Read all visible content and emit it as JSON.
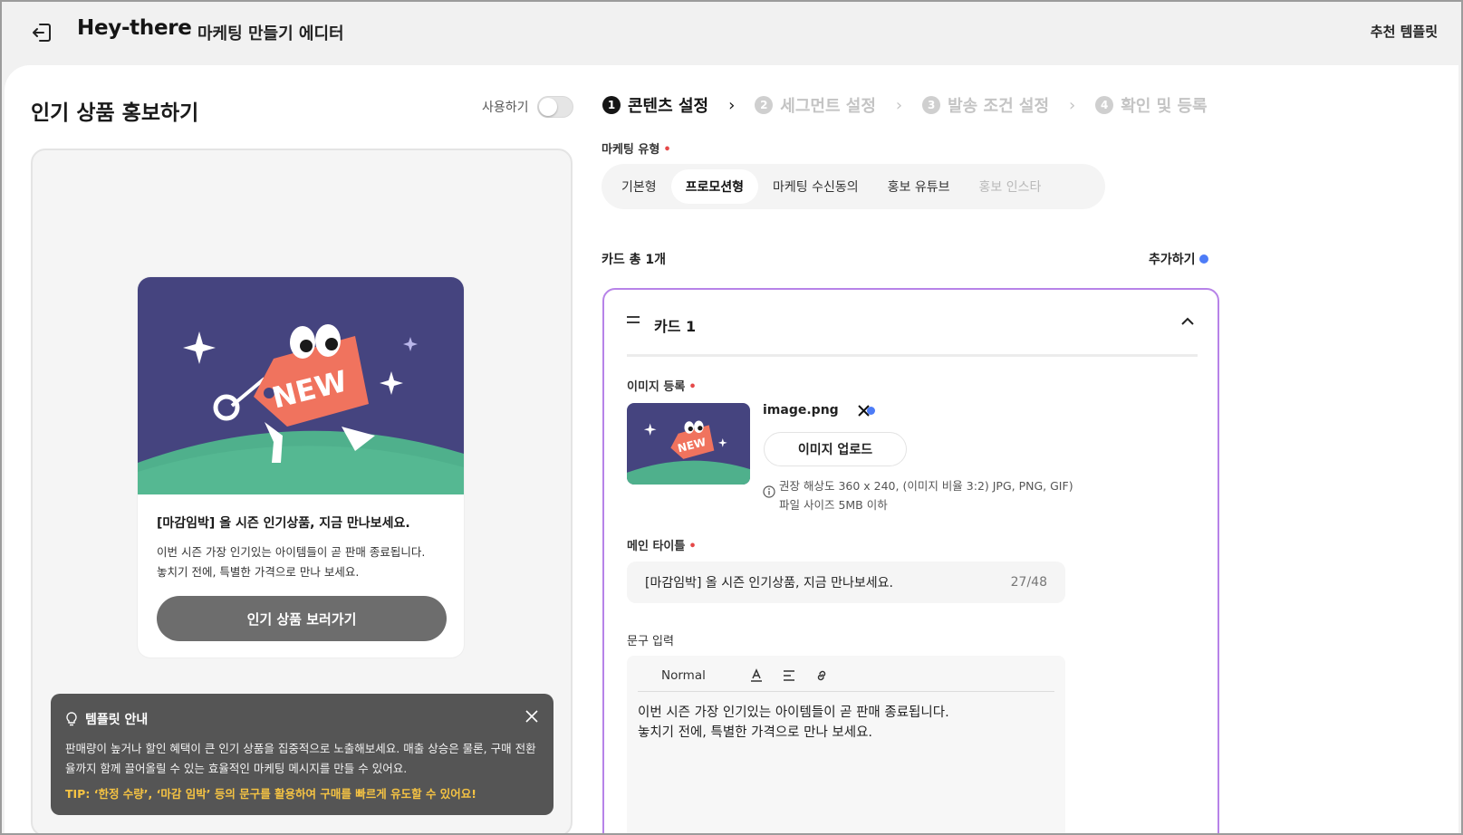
{
  "header": {
    "brand": "Hey-there",
    "subtitle": "마케팅 만들기 에디터",
    "recommend": "추천 템플릿"
  },
  "left": {
    "title": "인기 상품 홍보하기",
    "toggle_label": "사용하기",
    "toggle_on": false,
    "preview": {
      "image_text": "NEW",
      "title": "[마감임박] 올 시즌 인기상품, 지금 만나보세요.",
      "desc": "이번 시즌 가장 인기있는 아이템들이 곧 판매 종료됩니다.\n놓치기 전에, 특별한 가격으로 만나 보세요.",
      "cta": "인기 상품 보러가기"
    },
    "tip": {
      "title": "템플릿 안내",
      "body": "판매량이 높거나 할인 혜택이 큰 인기 상품을 집중적으로 노출해보세요. 매출 상승은 물론, 구매 전환율까지 함께 끌어올릴 수 있는 효율적인 마케팅 메시지를 만들 수 있어요.",
      "tip_line": "TIP: ‘한정 수량’, ‘마감 임박’ 등의 문구를 활용하여 구매를 빠르게 유도할 수 있어요!"
    }
  },
  "steps": [
    {
      "num": "1",
      "label": "콘텐츠 설정",
      "active": true
    },
    {
      "num": "2",
      "label": "세그먼트 설정",
      "active": false
    },
    {
      "num": "3",
      "label": "발송 조건 설정",
      "active": false
    },
    {
      "num": "4",
      "label": "확인 및 등록",
      "active": false
    }
  ],
  "form": {
    "marketing_type_label": "마케팅 유형",
    "types": [
      {
        "label": "기본형",
        "state": "normal"
      },
      {
        "label": "프로모션형",
        "state": "active"
      },
      {
        "label": "마케팅 수신동의",
        "state": "normal"
      },
      {
        "label": "홍보 유튜브",
        "state": "normal"
      },
      {
        "label": "홍보 인스타",
        "state": "disabled"
      }
    ],
    "cards_count": "카드 총 1개",
    "add_label": "추가하기",
    "card": {
      "name": "카드 1",
      "image_label": "이미지 등록",
      "file_name": "image.png",
      "upload_label": "이미지 업로드",
      "upload_hint": "권장 해상도 360 x 240, (이미지 비율 3:2) JPG, PNG, GIF)\n파일 사이즈 5MB 이하",
      "main_title_label": "메인 타이틀",
      "main_title_value": "[마감임박] 올 시즌 인기상품, 지금 만나보세요.",
      "main_title_count": "27/48",
      "text_label": "문구 입력",
      "toolbar_format": "Normal",
      "text_value": "이번 시즌 가장 인기있는 아이템들이 곧 판매 종료됩니다.\n놓치기 전에, 특별한 가격으로 만나 보세요."
    }
  },
  "colors": {
    "accent_purple": "#b783e8",
    "dot_blue": "#4d7cf7",
    "required_red": "#e54848",
    "illus_bg": "#45447f",
    "illus_ground": "#4fb08c",
    "tag_coral": "#f0735e",
    "tip_yellow": "#f5c343"
  }
}
